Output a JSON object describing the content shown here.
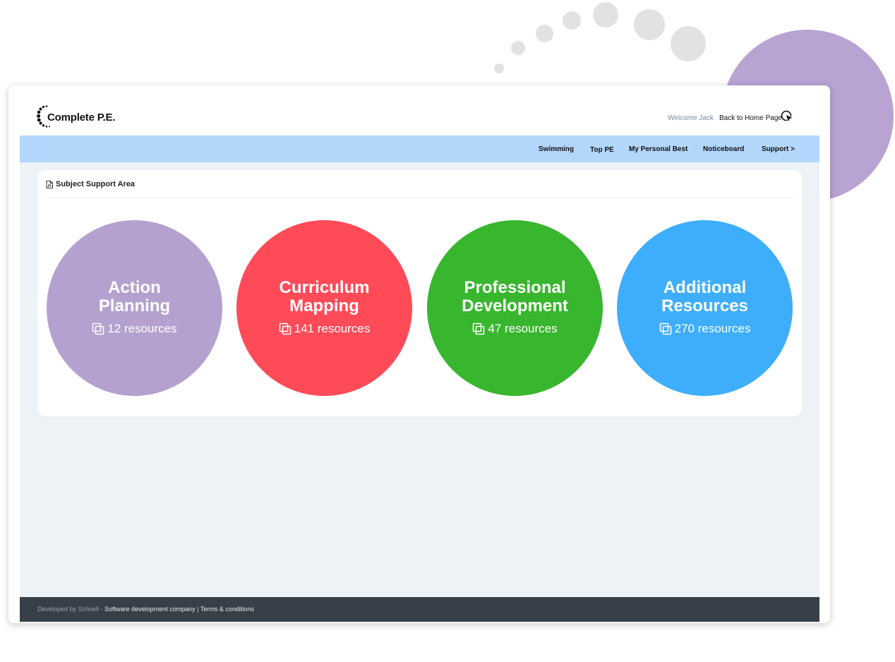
{
  "header": {
    "logo_text": "Complete P.E.",
    "welcome": "Welcome Jack",
    "home_link": "Back to Home Page"
  },
  "nav": {
    "items": [
      "Swimming",
      "Top PE",
      "My Personal Best",
      "Noticeboard",
      "Support >"
    ]
  },
  "card": {
    "title": "Subject Support Area",
    "areas": [
      {
        "title_line1": "Action",
        "title_line2": "Planning",
        "count": "12 resources",
        "color": "#b4a1cf"
      },
      {
        "title_line1": "Curriculum",
        "title_line2": "Mapping",
        "count": "141 resources",
        "color": "#ff4b58"
      },
      {
        "title_line1": "Professional",
        "title_line2": "Development",
        "count": "47 resources",
        "color": "#38b62e"
      },
      {
        "title_line1": "Additional",
        "title_line2": "Resources",
        "count": "270 resources",
        "color": "#3eaefc"
      }
    ]
  },
  "footer": {
    "developed_by": "Developed by Schnell -",
    "company_link": "Software development company",
    "separator": "|",
    "terms": "Terms & conditions"
  },
  "colors": {
    "navbar": "#b3d7fb",
    "page_bg": "#edf2f7",
    "footer_bg": "#373f48",
    "accent_blob": "#b9a3d3"
  }
}
